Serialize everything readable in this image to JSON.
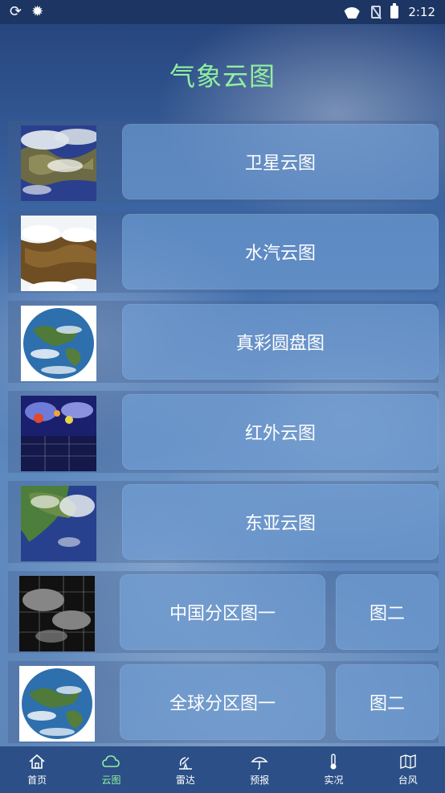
{
  "status": {
    "time": "2:12"
  },
  "title": "气象云图",
  "items": [
    {
      "label": "卫星云图",
      "thumb": "satellite-map"
    },
    {
      "label": "水汽云图",
      "thumb": "water-vapor-map"
    },
    {
      "label": "真彩圆盘图",
      "thumb": "true-color-disk"
    },
    {
      "label": "红外云图",
      "thumb": "infrared-map"
    },
    {
      "label": "东亚云图",
      "thumb": "east-asia-map"
    },
    {
      "label": "中国分区图一",
      "label2": "图二",
      "thumb": "china-region-map"
    },
    {
      "label": "全球分区图一",
      "label2": "图二",
      "thumb": "global-disk"
    }
  ],
  "tabs": [
    {
      "label": "首页",
      "icon": "home-icon"
    },
    {
      "label": "云图",
      "icon": "cloud-icon",
      "active": true
    },
    {
      "label": "雷达",
      "icon": "radar-icon"
    },
    {
      "label": "预报",
      "icon": "umbrella-icon"
    },
    {
      "label": "实况",
      "icon": "thermometer-icon"
    },
    {
      "label": "台风",
      "icon": "map-icon"
    }
  ],
  "colors": {
    "title": "#8ff0a0",
    "active_tab": "#8ff0a0",
    "tabbar": "#2b4f86",
    "statusbar": "#1c3563"
  }
}
